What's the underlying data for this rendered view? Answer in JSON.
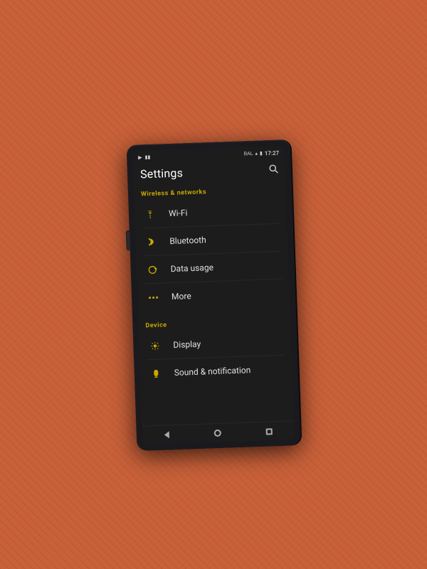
{
  "statusBar": {
    "leftIcons": [
      "media-icon",
      "battery-icon"
    ],
    "rightText": "BAL",
    "time": "17:27"
  },
  "header": {
    "title": "Settings",
    "searchLabel": "search"
  },
  "sections": [
    {
      "id": "wireless",
      "label": "Wireless & networks",
      "items": [
        {
          "id": "wifi",
          "icon": "wifi-icon",
          "label": "Wi-Fi"
        },
        {
          "id": "bluetooth",
          "icon": "bluetooth-icon",
          "label": "Bluetooth"
        },
        {
          "id": "data-usage",
          "icon": "data-usage-icon",
          "label": "Data usage"
        },
        {
          "id": "more",
          "icon": "more-icon",
          "label": "More"
        }
      ]
    },
    {
      "id": "device",
      "label": "Device",
      "items": [
        {
          "id": "display",
          "icon": "display-icon",
          "label": "Display"
        },
        {
          "id": "sound",
          "icon": "sound-icon",
          "label": "Sound & notification"
        }
      ]
    }
  ],
  "navBar": {
    "back": "back-icon",
    "home": "home-icon",
    "recents": "recents-icon"
  },
  "colors": {
    "accent": "#c8a800",
    "background": "#1c1c1c",
    "text": "#e0e0e0",
    "statusText": "#cccccc"
  }
}
